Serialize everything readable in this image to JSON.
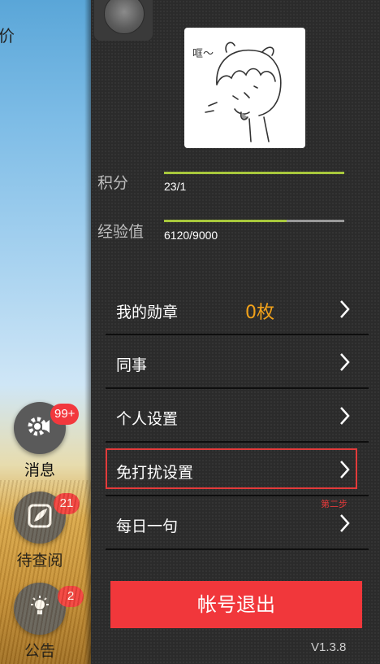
{
  "left_panel": {
    "top_glyph": "价",
    "buttons": [
      {
        "label": "消息",
        "badge": "99+",
        "icon": "gear-speaker-icon"
      },
      {
        "label": "待查阅",
        "badge": "21",
        "icon": "feather-pen-icon"
      },
      {
        "label": "公告",
        "badge": "2",
        "icon": "lightbulb-icon"
      }
    ]
  },
  "profile": {
    "avatar_caption": "哐～",
    "points_label": "积分",
    "points_value": "23/1",
    "points_progress": 1.0,
    "exp_label": "经验值",
    "exp_value": "6120/9000",
    "exp_progress": 0.68
  },
  "menu": {
    "medals_label": "我的勋章",
    "medals_count": "0枚",
    "colleagues_label": "同事",
    "personal_settings_label": "个人设置",
    "dnd_settings_label": "免打扰设置",
    "daily_quote_label": "每日一句",
    "step_note": "第二步"
  },
  "logout_label": "帐号退出",
  "version": "V1.3.8",
  "colors": {
    "accent_red": "#f1373b",
    "medal_orange": "#f2a21a",
    "progress_green": "#a8c83c"
  }
}
